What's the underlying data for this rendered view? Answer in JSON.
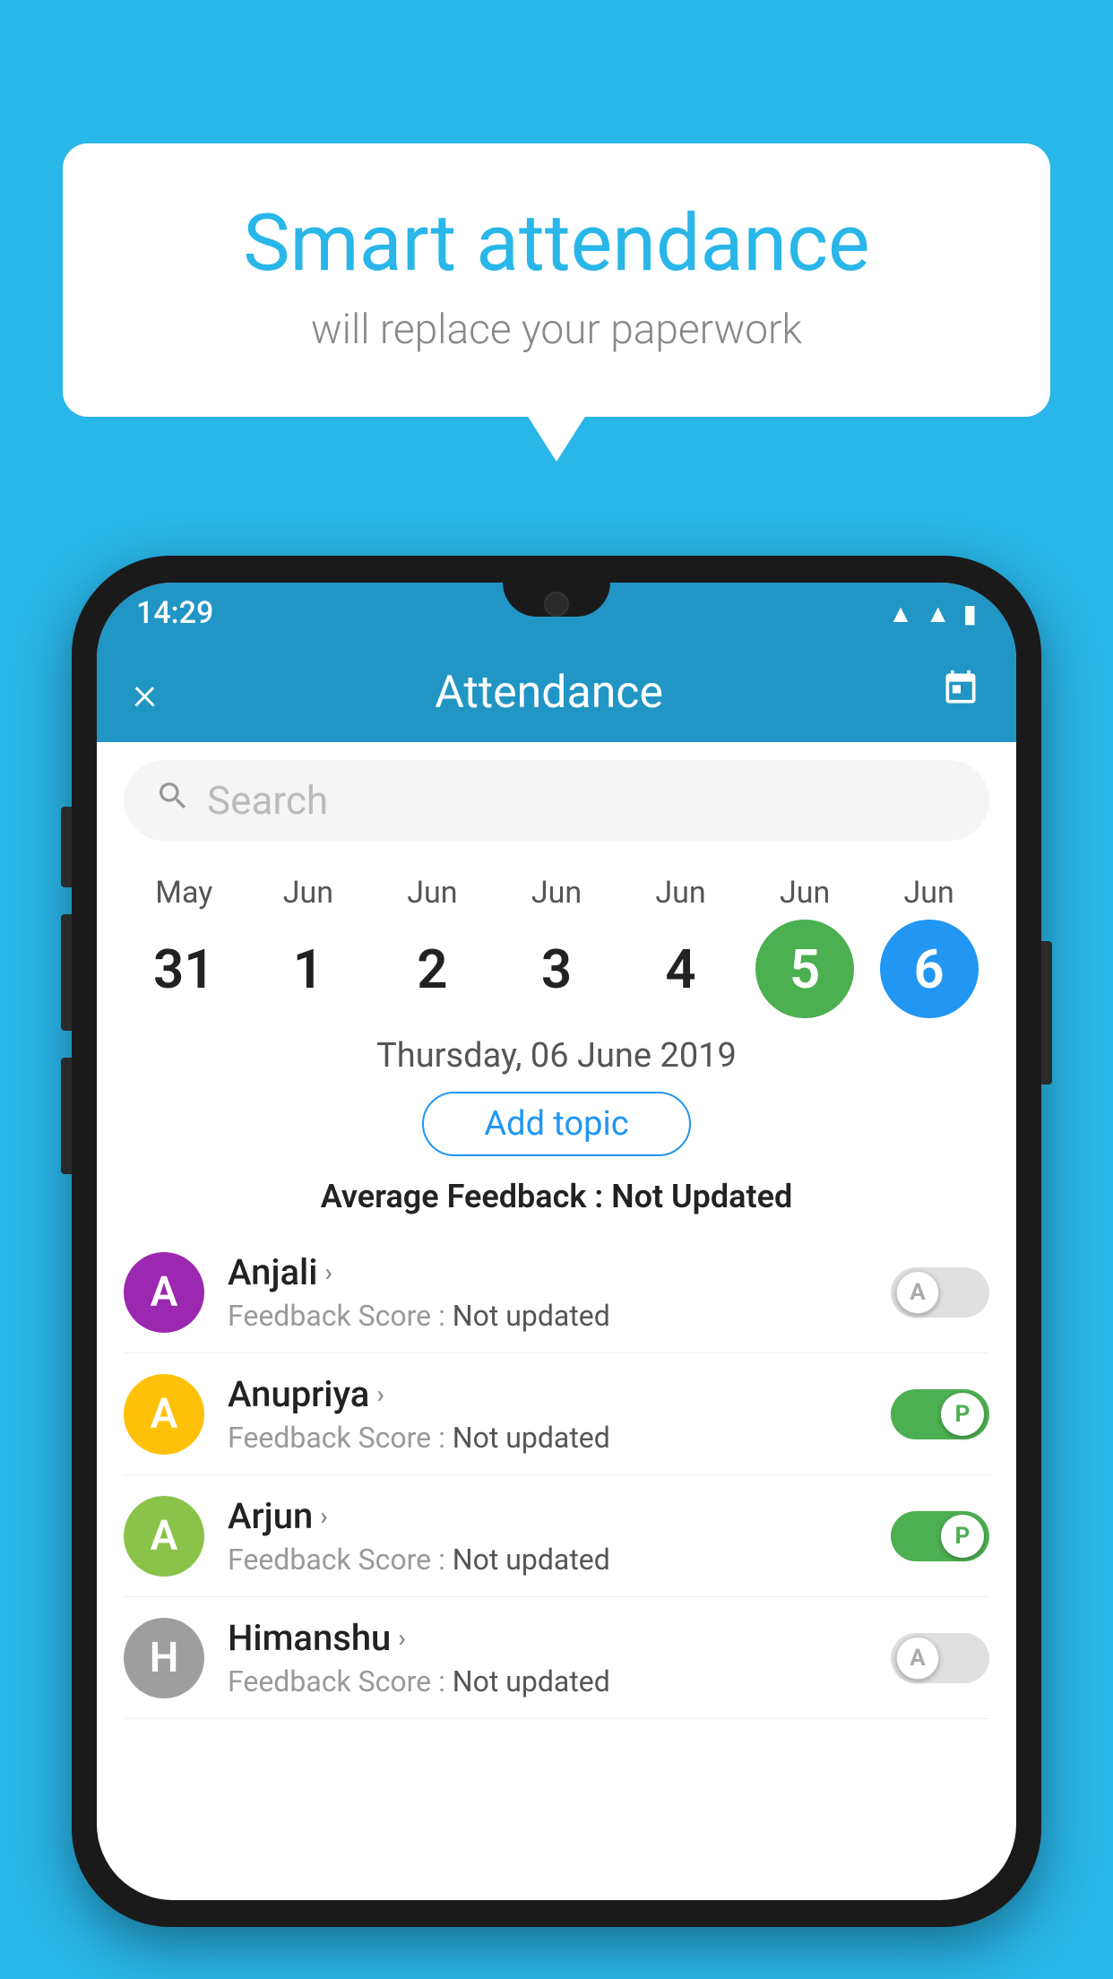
{
  "background_color": "#29B6E8",
  "bubble": {
    "title": "Smart attendance",
    "subtitle": "will replace your paperwork"
  },
  "status_bar": {
    "time": "14:29",
    "icons": [
      "wifi",
      "signal",
      "battery"
    ]
  },
  "header": {
    "close_label": "×",
    "title": "Attendance",
    "calendar_icon": "📅"
  },
  "search": {
    "placeholder": "Search"
  },
  "calendar": {
    "days": [
      {
        "month": "May",
        "date": "31",
        "type": "normal"
      },
      {
        "month": "Jun",
        "date": "1",
        "type": "normal"
      },
      {
        "month": "Jun",
        "date": "2",
        "type": "normal"
      },
      {
        "month": "Jun",
        "date": "3",
        "type": "normal"
      },
      {
        "month": "Jun",
        "date": "4",
        "type": "normal"
      },
      {
        "month": "Jun",
        "date": "5",
        "type": "today"
      },
      {
        "month": "Jun",
        "date": "6",
        "type": "selected"
      }
    ]
  },
  "selected_date_label": "Thursday, 06 June 2019",
  "add_topic_label": "Add topic",
  "average_feedback": {
    "label": "Average Feedback : ",
    "value": "Not Updated"
  },
  "students": [
    {
      "name": "Anjali",
      "avatar_letter": "A",
      "avatar_color": "#9C27B0",
      "feedback_label": "Feedback Score : ",
      "feedback_value": "Not updated",
      "toggle_state": "off",
      "toggle_letter": "A"
    },
    {
      "name": "Anupriya",
      "avatar_letter": "A",
      "avatar_color": "#FFC107",
      "feedback_label": "Feedback Score : ",
      "feedback_value": "Not updated",
      "toggle_state": "on",
      "toggle_letter": "P"
    },
    {
      "name": "Arjun",
      "avatar_letter": "A",
      "avatar_color": "#8BC34A",
      "feedback_label": "Feedback Score : ",
      "feedback_value": "Not updated",
      "toggle_state": "on",
      "toggle_letter": "P"
    },
    {
      "name": "Himanshu",
      "avatar_letter": "H",
      "avatar_color": "#9E9E9E",
      "feedback_label": "Feedback Score : ",
      "feedback_value": "Not updated",
      "toggle_state": "off",
      "toggle_letter": "A"
    }
  ]
}
